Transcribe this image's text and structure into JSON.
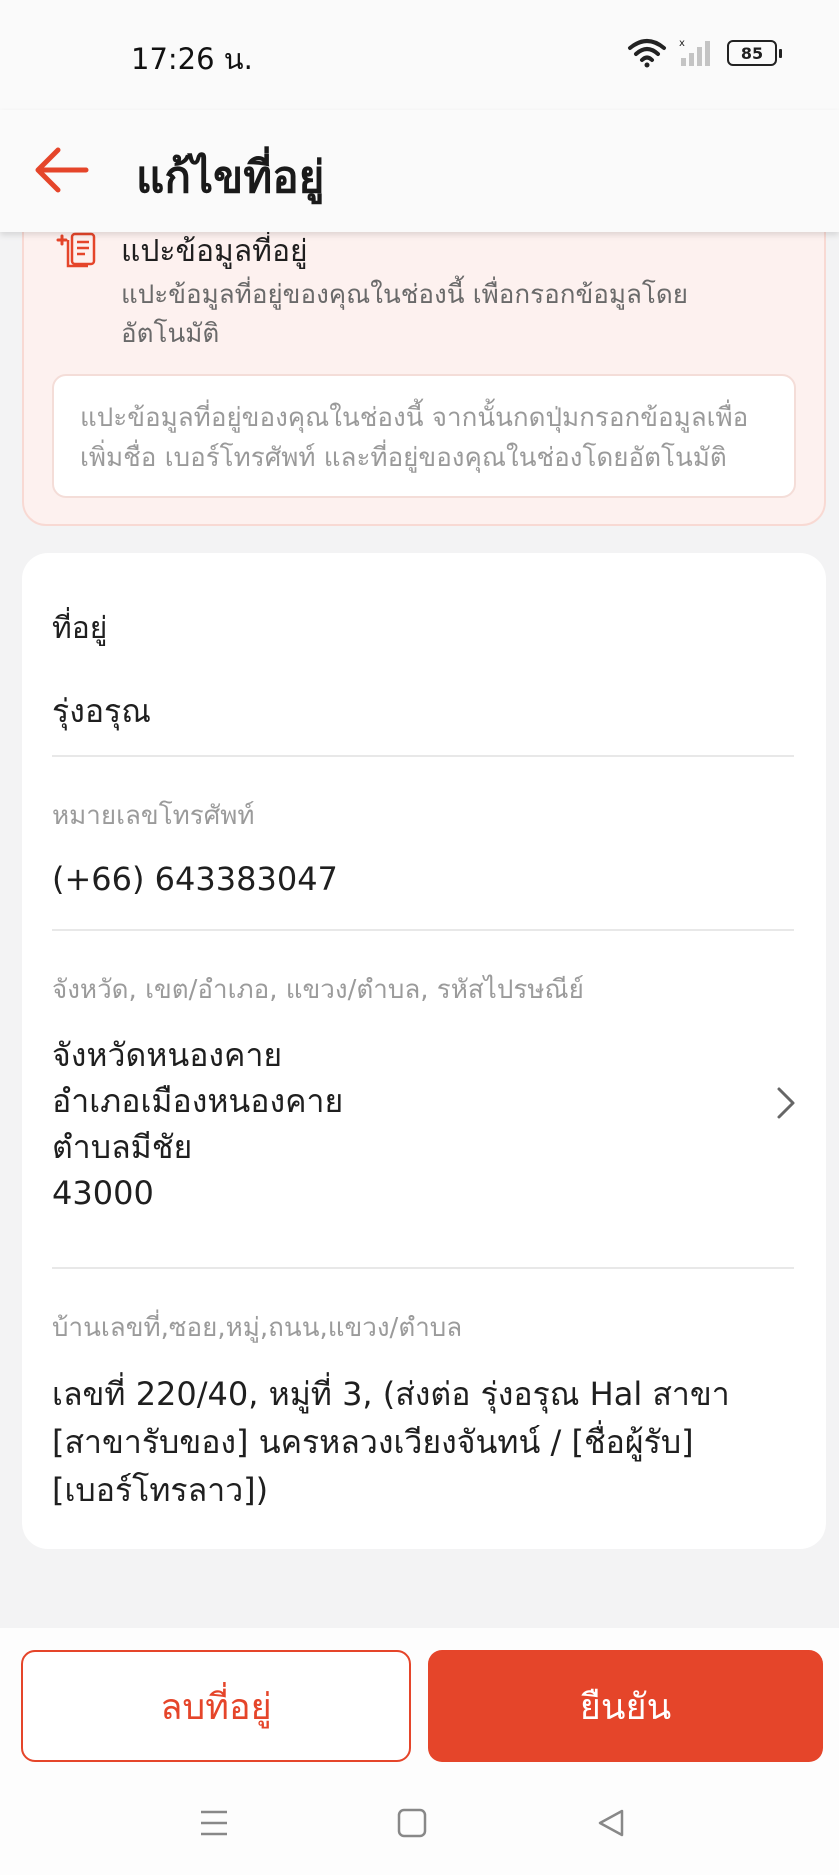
{
  "status_bar": {
    "time": "17:26 น.",
    "battery": "85"
  },
  "header": {
    "title": "แก้ไขที่อยู่"
  },
  "paste": {
    "title": "แปะข้อมูลที่อยู่",
    "description": "แปะข้อมูลที่อยู่ของคุณในช่องนี้ เพื่อกรอกข้อมูลโดยอัตโนมัติ",
    "placeholder": "แปะข้อมูลที่อยู่ของคุณในช่องนี้ จากนั้นกดปุ่มกรอกข้อมูลเพื่อเพิ่มชื่อ เบอร์โทรศัพท์ และที่อยู่ของคุณในช่องโดยอัตโนมัติ"
  },
  "form": {
    "name": {
      "label": "ที่อยู่",
      "value": "รุ่งอรุณ"
    },
    "phone": {
      "label": "หมายเลขโทรศัพท์",
      "value": "(+66) 643383047"
    },
    "region": {
      "label": "จังหวัด, เขต/อำเภอ, แขวง/ตำบล, รหัสไปรษณีย์",
      "lines": [
        "จังหวัดหนองคาย",
        "อำเภอเมืองหนองคาย",
        "ตำบลมีชัย",
        "43000"
      ]
    },
    "detail": {
      "label": "บ้านเลขที่,ซอย,หมู่,ถนน,แขวง/ตำบล",
      "lines": [
        "เลขที่ 220/40, หมู่ที่ 3, (ส่งต่อ รุ่งอรุณ Hal สาขา",
        "[สาขารับของ] นครหลวงเวียงจันทน์ / [ชื่อผู้รับ]",
        "[เบอร์โทรลาว])"
      ]
    }
  },
  "actions": {
    "delete_label": "ลบที่อยู่",
    "confirm_label": "ยืนยัน"
  },
  "colors": {
    "accent": "#e5452a",
    "paste_bg": "#fdf1ef"
  }
}
